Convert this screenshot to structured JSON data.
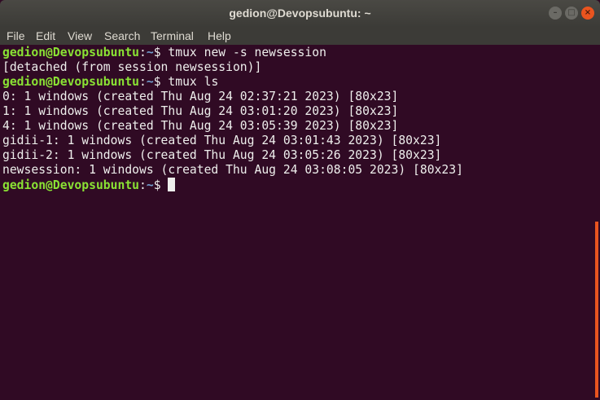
{
  "window": {
    "title": "gedion@Devopsubuntu: ~",
    "minimize_icon": "–",
    "maximize_icon": "□",
    "close_icon": "×"
  },
  "menu": [
    "File",
    "Edit",
    "View",
    "Search",
    "Terminal",
    "Help"
  ],
  "prompt": {
    "user": "gedion@Devopsubuntu",
    "sep": ":",
    "path": "~",
    "sym": "$ "
  },
  "lines": [
    {
      "type": "cmd",
      "text": "tmux new -s newsession"
    },
    {
      "type": "out",
      "text": "[detached (from session newsession)]"
    },
    {
      "type": "cmd",
      "text": "tmux ls"
    },
    {
      "type": "out",
      "text": "0: 1 windows (created Thu Aug 24 02:37:21 2023) [80x23]"
    },
    {
      "type": "out",
      "text": "1: 1 windows (created Thu Aug 24 03:01:20 2023) [80x23]"
    },
    {
      "type": "out",
      "text": "4: 1 windows (created Thu Aug 24 03:05:39 2023) [80x23]"
    },
    {
      "type": "out",
      "text": "gidii-1: 1 windows (created Thu Aug 24 03:01:43 2023) [80x23]"
    },
    {
      "type": "out",
      "text": "gidii-2: 1 windows (created Thu Aug 24 03:05:26 2023) [80x23]"
    },
    {
      "type": "out",
      "text": "newsession: 1 windows (created Thu Aug 24 03:08:05 2023) [80x23]"
    },
    {
      "type": "cmd",
      "text": ""
    }
  ],
  "colors": {
    "background": "#300a24",
    "user": "#8ae234",
    "path": "#729fcf",
    "accent": "#e9541f"
  }
}
